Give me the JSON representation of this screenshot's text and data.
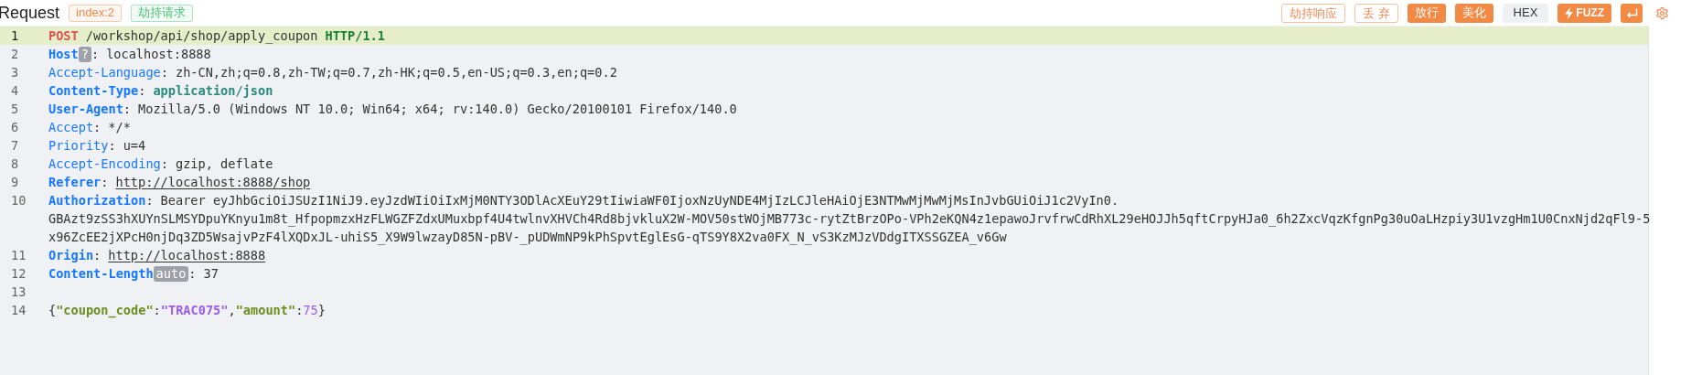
{
  "header": {
    "title": "Request",
    "tags": [
      {
        "label": "index:2",
        "color": "#f0884a"
      },
      {
        "label": "劫持请求",
        "color": "#4cc07a"
      }
    ],
    "actions": [
      {
        "label": "劫持响应",
        "kind": "outline"
      },
      {
        "label": "丢 弃",
        "kind": "outline"
      },
      {
        "label": "放行",
        "kind": "filled"
      },
      {
        "label": "美化",
        "kind": "filled"
      },
      {
        "label": "HEX",
        "kind": "toggle"
      },
      {
        "label": "FUZZ",
        "kind": "fuzz"
      },
      {
        "kind": "enter"
      },
      {
        "kind": "settings"
      }
    ]
  },
  "editor": {
    "lines": [
      {
        "number": "1",
        "kind": "request_line",
        "selected": true,
        "method": "POST",
        "path": "/workshop/api/shop/apply_coupon",
        "version": "HTTP/1.1"
      },
      {
        "number": "2",
        "kind": "header",
        "selected": false,
        "name": "Host",
        "important": true,
        "badge": "?",
        "separator": ":",
        "value": "localhost:8888",
        "link": false,
        "emphasized": false
      },
      {
        "number": "3",
        "kind": "header",
        "selected": false,
        "name": "Accept-Language",
        "important": false,
        "separator": ":",
        "value": "zh-CN,zh;q=0.8,zh-TW;q=0.7,zh-HK;q=0.5,en-US;q=0.3,en;q=0.2",
        "link": false,
        "emphasized": false
      },
      {
        "number": "4",
        "kind": "header",
        "selected": false,
        "name": "Content-Type",
        "important": true,
        "separator": ":",
        "value": "application/json",
        "link": false,
        "emphasized": true
      },
      {
        "number": "5",
        "kind": "header",
        "selected": false,
        "name": "User-Agent",
        "important": true,
        "separator": ":",
        "value": "Mozilla/5.0 (Windows NT 10.0; Win64; x64; rv:140.0) Gecko/20100101 Firefox/140.0",
        "link": false,
        "emphasized": false
      },
      {
        "number": "6",
        "kind": "header",
        "selected": false,
        "name": "Accept",
        "important": false,
        "separator": ":",
        "value": "*/*",
        "link": false,
        "emphasized": false
      },
      {
        "number": "7",
        "kind": "header",
        "selected": false,
        "name": "Priority",
        "important": false,
        "separator": ":",
        "value": "u=4",
        "link": false,
        "emphasized": false
      },
      {
        "number": "8",
        "kind": "header",
        "selected": false,
        "name": "Accept-Encoding",
        "important": false,
        "separator": ":",
        "value": "gzip, deflate",
        "link": false,
        "emphasized": false
      },
      {
        "number": "9",
        "kind": "header",
        "selected": false,
        "name": "Referer",
        "important": true,
        "separator": ":",
        "value": "http://localhost:8888/shop",
        "link": true,
        "emphasized": false
      },
      {
        "number": "10",
        "kind": "header",
        "selected": false,
        "name": "Authorization",
        "important": true,
        "separator": ":",
        "value": "Bearer eyJhbGciOiJSUzI1NiJ9.eyJzdWIiOiIxMjM0NTY3ODlAcXEuY29tIiwiaWF0IjoxNzUyNDE4MjIzLCJleHAiOjE3NTMwMjMwMjMsInJvbGUiOiJ1c2VyIn0.",
        "link": false,
        "emphasized": false,
        "continuation": [
          "GBAzt9zSS3hXUYnSLMSYDpuYKnyu1m8t_HfpopmzxHzFLWGZFZdxUMuxbpf4U4twlnvXHVCh4Rd8bjvkluX2W-MOV50stWOjMB773c-rytZtBrzOPo-VPh2eKQN4z1epawoJrvfrwCdRhXL29eHOJJh5qftCrpyHJa0_6h2ZxcVqzKfgnPg30uOaLHzpiy3U1vzgHm1U0CnxNjd2qFl9-5",
          "x96ZcEE2jXPcH0njDq3ZD5WsajvPzF4lXQDxJL-uhiS5_X9W9lwzayD85N-pBV-_pUDWmNP9kPhSpvtEglEsG-qTS9Y8X2va0FX_N_vS3KzMJzVDdgITXSSGZEA_v6Gw"
        ]
      },
      {
        "number": "11",
        "kind": "header",
        "selected": false,
        "name": "Origin",
        "important": true,
        "separator": ":",
        "value": "http://localhost:8888",
        "link": true,
        "emphasized": false
      },
      {
        "number": "12",
        "kind": "header",
        "selected": false,
        "name": "Content-Length",
        "important": true,
        "badge": "auto",
        "separator": ":",
        "value": "37",
        "link": false,
        "emphasized": false
      },
      {
        "number": "13",
        "kind": "blank",
        "selected": false
      },
      {
        "number": "14",
        "kind": "body",
        "selected": false,
        "tokens": [
          {
            "text": "{",
            "kind": "punct"
          },
          {
            "text": "\"coupon_code\"",
            "kind": "key"
          },
          {
            "text": ":",
            "kind": "punct"
          },
          {
            "text": "\"TRAC075\"",
            "kind": "string"
          },
          {
            "text": ",",
            "kind": "punct"
          },
          {
            "text": "\"amount\"",
            "kind": "key"
          },
          {
            "text": ":",
            "kind": "punct"
          },
          {
            "text": "75",
            "kind": "number"
          },
          {
            "text": "}",
            "kind": "punct"
          }
        ]
      }
    ]
  }
}
